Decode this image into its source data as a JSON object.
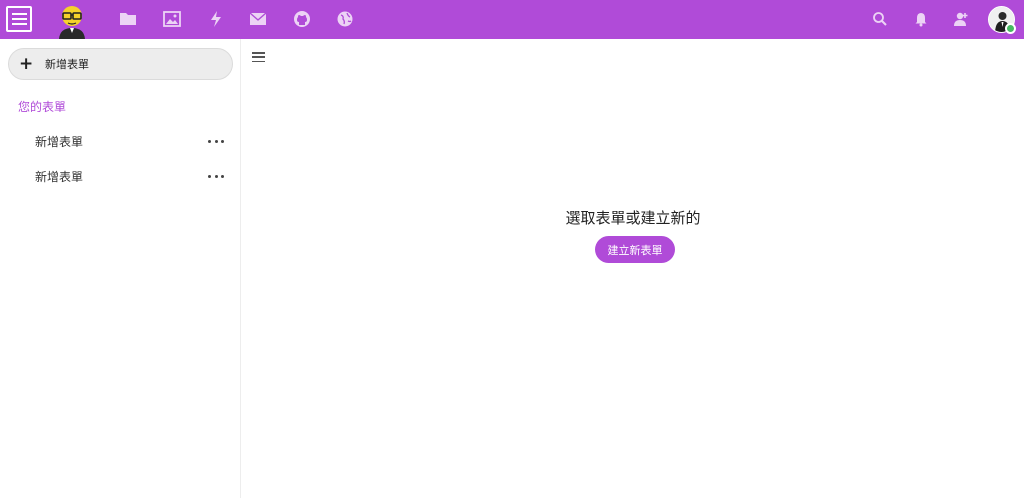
{
  "colors": {
    "brand": "#b04bd8",
    "online_status": "#46ba61"
  },
  "topbar": {
    "icons": [
      "menu-icon",
      "mascot-logo",
      "folder-icon",
      "image-icon",
      "activity-icon",
      "mail-icon",
      "github-icon",
      "globe-icon"
    ],
    "right_icons": [
      "search-icon",
      "bell-icon",
      "contacts-icon",
      "user-avatar"
    ]
  },
  "sidebar": {
    "new_form_label": "新增表單",
    "section_title": "您的表單",
    "items": [
      {
        "label": "新增表單"
      },
      {
        "label": "新增表單"
      }
    ]
  },
  "main": {
    "empty_title": "選取表單或建立新的",
    "create_button": "建立新表單"
  }
}
